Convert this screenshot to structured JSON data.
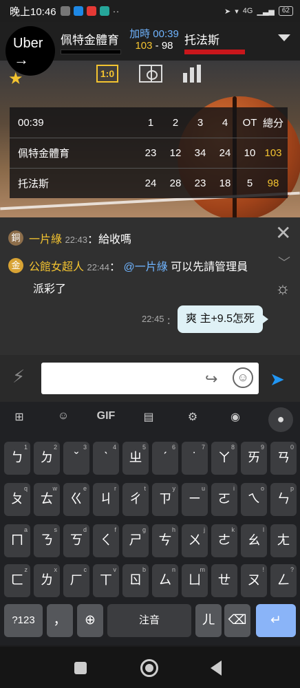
{
  "status_bar": {
    "time": "晚上10:46",
    "right_text": "4G",
    "battery": "62"
  },
  "uber": {
    "label": "Uber",
    "arrow": "→"
  },
  "match": {
    "home_team": "佩特金體育",
    "away_team": "托法斯",
    "period": "加時 00:39",
    "score_home": "103",
    "score_sep": " - ",
    "score_away": "98",
    "home_color": "#000000",
    "away_color": "#c9161b"
  },
  "tabs": {
    "score_tab": "1:0"
  },
  "box_score": {
    "header": [
      "00:39",
      "1",
      "2",
      "3",
      "4",
      "OT",
      "總分"
    ],
    "rows": [
      {
        "team": "佩特金體育",
        "values": [
          "23",
          "12",
          "34",
          "24",
          "10",
          "103"
        ]
      },
      {
        "team": "托法斯",
        "values": [
          "24",
          "28",
          "23",
          "18",
          "5",
          "98"
        ]
      }
    ]
  },
  "chat": {
    "messages": [
      {
        "badge": "銅",
        "user": "一片綠",
        "time": "22:43",
        "text": "：給收嗎"
      },
      {
        "badge": "金",
        "user": "公館女超人",
        "time": "22:44",
        "mention": "@一片綠",
        "text": " 可以先請管理員",
        "text2": "派彩了"
      }
    ],
    "own_message": {
      "time": "22:45",
      "text": "爽  主+9.5怎死"
    }
  },
  "keyboard": {
    "toolbar": [
      "⊞",
      "☺",
      "GIF",
      "▤",
      "⚙",
      "◉"
    ],
    "rows": [
      [
        [
          "ㄅ",
          "1"
        ],
        [
          "ㄉ",
          "2"
        ],
        [
          "ˇ",
          "3"
        ],
        [
          "ˋ",
          "4"
        ],
        [
          "ㄓ",
          "5"
        ],
        [
          "ˊ",
          "6"
        ],
        [
          "˙",
          "7"
        ],
        [
          "ㄚ",
          "8"
        ],
        [
          "ㄞ",
          "9"
        ],
        [
          "ㄢ",
          "0"
        ]
      ],
      [
        [
          "ㄆ",
          "q"
        ],
        [
          "ㄊ",
          "w"
        ],
        [
          "ㄍ",
          "e"
        ],
        [
          "ㄐ",
          "r"
        ],
        [
          "ㄔ",
          "t"
        ],
        [
          "ㄗ",
          "y"
        ],
        [
          "ㄧ",
          "u"
        ],
        [
          "ㄛ",
          "i"
        ],
        [
          "ㄟ",
          "o"
        ],
        [
          "ㄣ",
          "p"
        ]
      ],
      [
        [
          "ㄇ",
          "a"
        ],
        [
          "ㄋ",
          "s"
        ],
        [
          "ㄎ",
          "d"
        ],
        [
          "ㄑ",
          "f"
        ],
        [
          "ㄕ",
          "g"
        ],
        [
          "ㄘ",
          "h"
        ],
        [
          "ㄨ",
          "j"
        ],
        [
          "ㄜ",
          "k"
        ],
        [
          "ㄠ",
          "l"
        ],
        [
          "ㄤ",
          ""
        ]
      ],
      [
        [
          "ㄈ",
          "z"
        ],
        [
          "ㄌ",
          "x"
        ],
        [
          "ㄏ",
          "c"
        ],
        [
          "ㄒ",
          "v"
        ],
        [
          "ㄖ",
          "b"
        ],
        [
          "ㄙ",
          "n"
        ],
        [
          "ㄩ",
          "m"
        ],
        [
          "ㄝ",
          ""
        ],
        [
          "ㄡ",
          "!"
        ],
        [
          "ㄥ",
          "?"
        ]
      ]
    ],
    "bottom": {
      "sym": "?123",
      "comma": "，",
      "space": "注音",
      "er": "ㄦ"
    }
  }
}
